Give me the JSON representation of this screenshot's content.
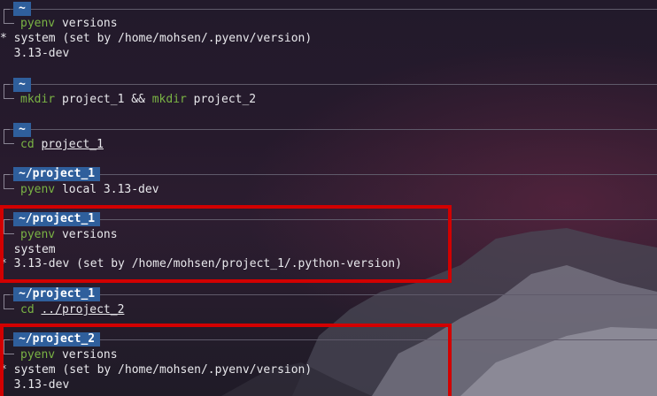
{
  "blocks": [
    {
      "dir": "~",
      "command": {
        "cmd": "pyenv",
        "args": " versions"
      },
      "output": [
        "* system (set by /home/mohsen/.pyenv/version)",
        "  3.13-dev"
      ]
    },
    {
      "dir": "~",
      "command": {
        "cmd": "mkdir",
        "args": " project_1 && ",
        "cmd2": "mkdir",
        "args2": " project_2"
      }
    },
    {
      "dir": "~",
      "command": {
        "cmd": "cd",
        "path": "project_1"
      }
    },
    {
      "dir": "~/project_1",
      "command": {
        "cmd": "pyenv",
        "args": " local 3.13-dev"
      }
    },
    {
      "dir": "~/project_1",
      "command": {
        "cmd": "pyenv",
        "args": " versions"
      },
      "output": [
        "  system",
        "* 3.13-dev (set by /home/mohsen/project_1/.python-version)"
      ]
    },
    {
      "dir": "~/project_1",
      "command": {
        "cmd": "cd",
        "path": "../project_2"
      }
    },
    {
      "dir": "~/project_2",
      "command": {
        "cmd": "pyenv",
        "args": " versions"
      },
      "output": [
        "* system (set by /home/mohsen/.pyenv/version)",
        "  3.13-dev"
      ]
    }
  ],
  "colors": {
    "highlight": "#d20000",
    "badge_bg": "#2f5f9c",
    "command": "#7ab344"
  }
}
